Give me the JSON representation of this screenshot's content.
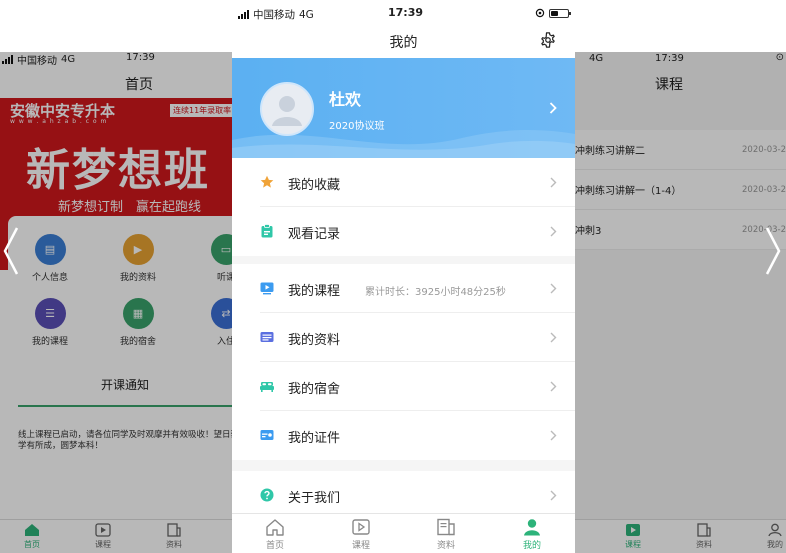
{
  "colors": {
    "accent_green": "#2db37a",
    "profile_blue": "#5bb0f2",
    "banner_red": "#d0181d"
  },
  "status_bar": {
    "carrier": "中国移动",
    "network": "4G",
    "time": "17:39"
  },
  "header": {
    "title": "我的",
    "settings_icon": "gear-icon"
  },
  "profile": {
    "name": "杜欢",
    "class": "2020协议班"
  },
  "menu_groups": [
    {
      "items": [
        {
          "icon": "star-icon",
          "label": "我的收藏",
          "extra": ""
        },
        {
          "icon": "clipboard-icon",
          "label": "观看记录",
          "extra": ""
        }
      ]
    },
    {
      "items": [
        {
          "icon": "video-icon",
          "label": "我的课程",
          "extra": "累计时长：3925小时48分25秒"
        },
        {
          "icon": "document-icon",
          "label": "我的资料",
          "extra": ""
        },
        {
          "icon": "bed-icon",
          "label": "我的宿舍",
          "extra": ""
        },
        {
          "icon": "id-card-icon",
          "label": "我的证件",
          "extra": ""
        }
      ]
    },
    {
      "items": [
        {
          "icon": "question-icon",
          "label": "关于我们",
          "extra": ""
        }
      ]
    }
  ],
  "tabbar": [
    {
      "icon": "home-icon",
      "label": "首页",
      "active": false
    },
    {
      "icon": "play-icon",
      "label": "课程",
      "active": false
    },
    {
      "icon": "materials-icon",
      "label": "资料",
      "active": false
    },
    {
      "icon": "user-icon",
      "label": "我的",
      "active": true
    }
  ],
  "left_screen": {
    "status": {
      "carrier": "中国移动",
      "network": "4G",
      "time": "17:39"
    },
    "title": "首页",
    "banner": {
      "logo": "安徽中安专升本",
      "url": "w w w . a h z a b . c o m",
      "badge": "连续11年录取率",
      "headline": "新梦想班",
      "slogan": "新梦想订制　赢在起跑线"
    },
    "menu": [
      {
        "label": "个人信息",
        "color": "#3b7fd6"
      },
      {
        "label": "我的资料",
        "color": "#e8a233"
      },
      {
        "label": "听课",
        "color": "#3aa36b"
      },
      {
        "label": "我的课程",
        "color": "#5a4fb8"
      },
      {
        "label": "我的宿舍",
        "color": "#3aa36b"
      },
      {
        "label": "入住",
        "color": "#3b6fd6"
      }
    ],
    "notice_tab": "开课通知",
    "notice_text": "线上课程已启动，请各位同学及时观摩并有效吸收！望日获，学有所成，圆梦本科！",
    "tabbar": [
      "首页",
      "课程",
      "资料"
    ]
  },
  "right_screen": {
    "status": {
      "network": "4G",
      "time": "17:39"
    },
    "title": "课程",
    "items": [
      {
        "title": "冲刺练习讲解二",
        "date": "2020-03-2"
      },
      {
        "title": "冲刺练习讲解一（1-4）",
        "date": "2020-03-2"
      },
      {
        "title": "冲刺3",
        "date": "2020-03-2"
      }
    ],
    "tabbar": [
      "课程",
      "资料",
      "我的"
    ]
  }
}
